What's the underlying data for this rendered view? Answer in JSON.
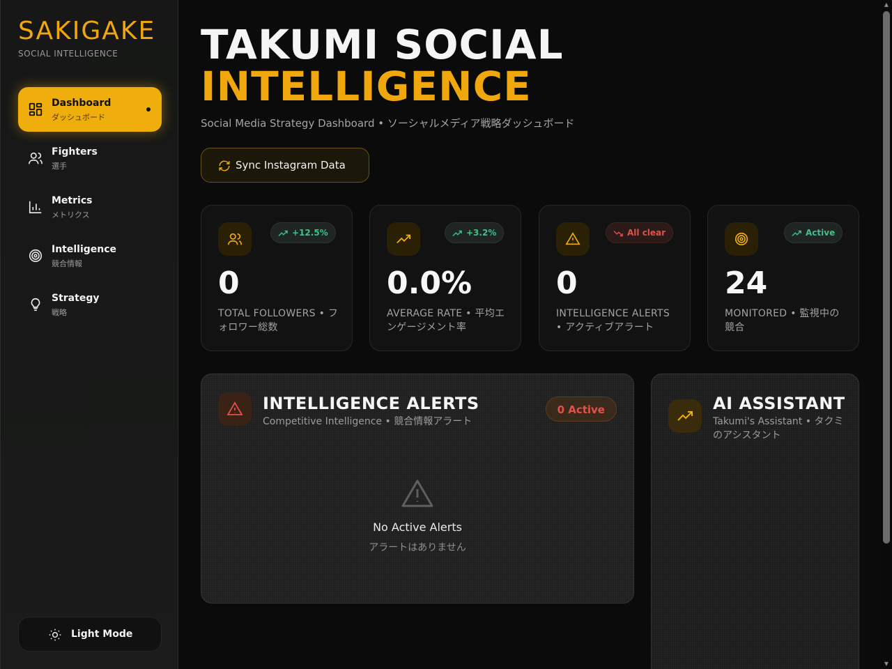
{
  "brand": {
    "title": "SAKIGAKE",
    "subtitle": "SOCIAL INTELLIGENCE"
  },
  "sidebar": {
    "items": [
      {
        "label": "Dashboard",
        "sub": "ダッシュボード",
        "icon": "dashboard-icon",
        "active": true
      },
      {
        "label": "Fighters",
        "sub": "選手",
        "icon": "users-icon",
        "active": false
      },
      {
        "label": "Metrics",
        "sub": "メトリクス",
        "icon": "bar-chart-icon",
        "active": false
      },
      {
        "label": "Intelligence",
        "sub": "競合情報",
        "icon": "target-icon",
        "active": false
      },
      {
        "label": "Strategy",
        "sub": "戦略",
        "icon": "lightbulb-icon",
        "active": false
      }
    ],
    "light_mode_label": "Light Mode"
  },
  "header": {
    "title_line1": "TAKUMI SOCIAL",
    "title_line2": "INTELLIGENCE",
    "subtitle": "Social Media Strategy Dashboard • ソーシャルメディア戦略ダッシュボード",
    "sync_label": "Sync Instagram Data"
  },
  "stats": [
    {
      "value": "0",
      "label": "TOTAL FOLLOWERS • フォロワー総数",
      "badge": "+12.5%",
      "badge_color": "#3cc28a",
      "icon": "users-icon"
    },
    {
      "value": "0.0%",
      "label": "AVERAGE RATE • 平均エンゲージメント率",
      "badge": "+3.2%",
      "badge_color": "#3cc28a",
      "icon": "trending-up-icon"
    },
    {
      "value": "0",
      "label": "INTELLIGENCE ALERTS • アクティブアラート",
      "badge": "All clear",
      "badge_color": "#e0524a",
      "icon": "alert-triangle-icon"
    },
    {
      "value": "24",
      "label": "MONITORED • 監視中の競合",
      "badge": "Active",
      "badge_color": "#3cc28a",
      "icon": "target-icon"
    }
  ],
  "alerts_panel": {
    "title": "INTELLIGENCE ALERTS",
    "subtitle": "Competitive Intelligence • 競合情報アラート",
    "badge": "0 Active",
    "empty_title": "No Active Alerts",
    "empty_sub": "アラートはありません"
  },
  "ai_panel": {
    "title": "AI ASSISTANT",
    "subtitle": "Takumi's Assistant • タクミのアシスタント"
  },
  "colors": {
    "accent": "#f0ae0c",
    "positive": "#3cc28a",
    "negative": "#e0524a",
    "background": "#0b0b0b"
  }
}
